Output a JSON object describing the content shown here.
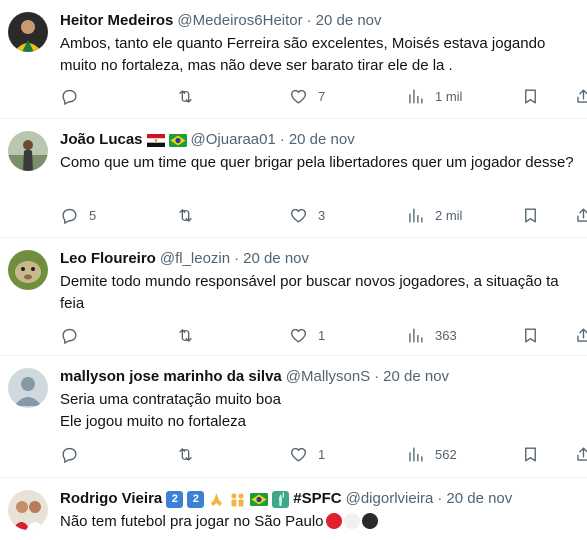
{
  "colors": {
    "text": "#0f1419",
    "secondary": "#536471",
    "divider": "#eff3f4"
  },
  "tweets": [
    {
      "name": "Heitor Medeiros",
      "handle": "@Medeiros6Heitor",
      "dot": "·",
      "time": "20 de nov",
      "text": "Ambos, tanto ele quanto Ferreira são excelentes, Moisés estava jogando muito no fortaleza, mas não deve ser barato tirar ele de la .",
      "replies": "",
      "retweets": "",
      "likes": "7",
      "views": "1 mil"
    },
    {
      "name": "João Lucas",
      "handle": "@Ojuaraa01",
      "dot": "·",
      "time": "20 de nov",
      "text": "Como que um time que quer brigar pela libertadores quer um jogador desse?",
      "replies": "5",
      "retweets": "",
      "likes": "3",
      "views": "2 mil"
    },
    {
      "name": "Leo Floureiro",
      "handle": "@fl_leozin",
      "dot": "·",
      "time": "20 de nov",
      "text": "Demite todo mundo responsável por buscar novos jogadores, a situação ta feia",
      "replies": "",
      "retweets": "",
      "likes": "1",
      "views": "363"
    },
    {
      "name": "mallyson jose marinho da silva",
      "handle": "@MallysonS",
      "dot": "·",
      "time": "20 de nov",
      "text": "Seria uma contratação muito boa\nEle jogou muito no fortaleza",
      "replies": "",
      "retweets": "",
      "likes": "1",
      "views": "562"
    },
    {
      "name": "Rodrigo Vieira",
      "name_suffix": "#SPFC",
      "name_emoji": [
        "2",
        "2"
      ],
      "handle": "@digorlvieira",
      "dot": "·",
      "time": "20 de nov",
      "text": "Não tem futebol pra jogar no São Paulo"
    }
  ]
}
